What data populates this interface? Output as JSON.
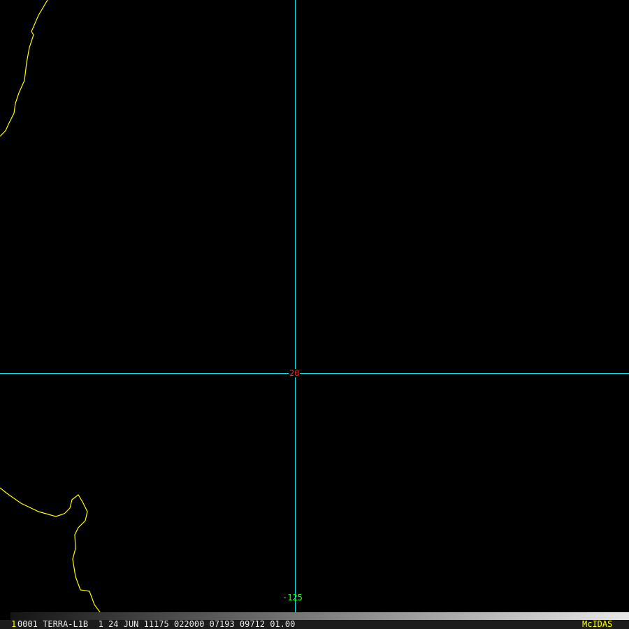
{
  "colors": {
    "coast": "#ffff00",
    "grid": "#00e5ee",
    "lat_label": "#ff2020",
    "lon_label": "#20ff20",
    "brand": "#ffff00"
  },
  "grid_labels": {
    "latitude": "20",
    "longitude": "-125"
  },
  "status_bar": {
    "frame": "1",
    "info": "0001 TERRA-L1B  1 24 JUN 11175 022000 07193 09712 01.00",
    "brand": "McIDAS"
  }
}
